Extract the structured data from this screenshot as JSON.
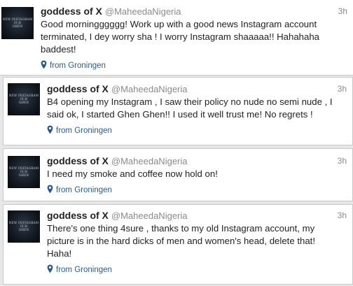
{
  "accent_color": "#2b5c89",
  "tweets": [
    {
      "name": "goddess of X",
      "handle": "@MaheedaNigeria",
      "time": "3h",
      "text": "Good morningggggg! Work up with a good news Instagram account terminated, I dey worry sha !   I worry Instagram shaaaaa!! Hahahaha baddest!",
      "location": "from Groningen",
      "avatar_text": "NEW INSTAGRAM\nIS H\nGHEN"
    },
    {
      "name": "goddess of X",
      "handle": "@MaheedaNigeria",
      "time": "3h",
      "text": "B4 opening my Instagram , I saw their policy no nude no semi nude , I said ok, I started Ghen  Ghen!! I used it well trust me! No regrets !",
      "location": "from Groningen",
      "avatar_text": "NEW INSTAGRAM\nIS H\nGHEN"
    },
    {
      "name": "goddess of X",
      "handle": "@MaheedaNigeria",
      "time": "3h",
      "text": "I need my smoke and coffee now hold on!",
      "location": "from Groningen",
      "avatar_text": "NEW INSTAGRAM\nIS H\nGHEN"
    },
    {
      "name": "goddess of X",
      "handle": "@MaheedaNigeria",
      "time": "3h",
      "text": "There's one thing 4sure , thanks to my old Instagram account, my picture is in the hard dicks of men and women's head, delete that! Haha!",
      "location": "from Groningen",
      "avatar_text": "NEW INSTAGRAM\nIS H\nGHEN"
    }
  ]
}
